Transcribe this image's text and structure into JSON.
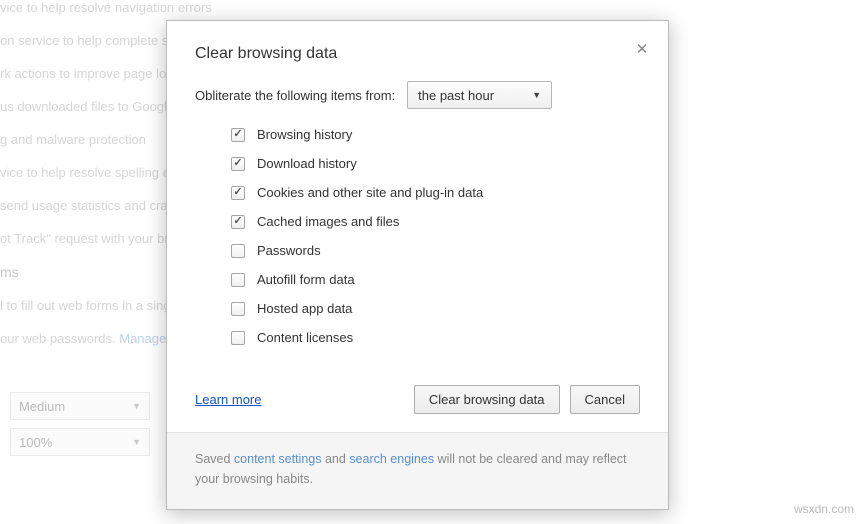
{
  "background": {
    "lines": [
      "vice to help resolve navigation errors",
      "on service to help complete sea",
      "rk actions to improve page load",
      "us downloaded files to Google",
      "g and malware protection",
      "vice to help resolve spelling erro",
      "send usage statistics and crash",
      "ot Track\" request with your brow"
    ],
    "section_title": "ms",
    "form_line_prefix": "l to fill out web forms in a singl",
    "pw_line_prefix": "our web passwords.  ",
    "manage_link": "Manage s",
    "select1": "Medium",
    "select2": "100%"
  },
  "dialog": {
    "title": "Clear browsing data",
    "obliterate_label": "Obliterate the following items from:",
    "time_range": "the past hour",
    "items": [
      {
        "label": "Browsing history",
        "checked": true
      },
      {
        "label": "Download history",
        "checked": true
      },
      {
        "label": "Cookies and other site and plug-in data",
        "checked": true
      },
      {
        "label": "Cached images and files",
        "checked": true
      },
      {
        "label": "Passwords",
        "checked": false
      },
      {
        "label": "Autofill form data",
        "checked": false
      },
      {
        "label": "Hosted app data",
        "checked": false
      },
      {
        "label": "Content licenses",
        "checked": false
      }
    ],
    "learn_more": "Learn more",
    "clear_button": "Clear browsing data",
    "cancel_button": "Cancel",
    "note_prefix": "Saved ",
    "note_link1": "content settings",
    "note_mid": " and ",
    "note_link2": "search engines",
    "note_suffix": " will not be cleared and may reflect your browsing habits."
  },
  "watermark": "wsxdn.com"
}
